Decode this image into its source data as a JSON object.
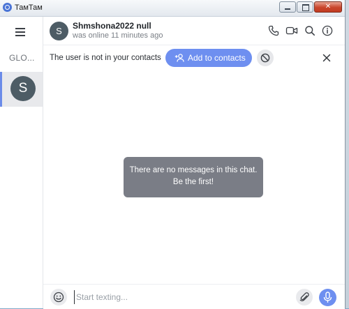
{
  "window": {
    "title": "ТамТам",
    "minimize_glyph": "",
    "maximize_glyph": "",
    "close_glyph": "✕"
  },
  "sidebar": {
    "global_tab": "GLO...",
    "chat": {
      "avatar_letter": "S"
    }
  },
  "header": {
    "avatar_letter": "S",
    "name": "Shmshona2022 null",
    "status": "was online 11 minutes ago",
    "icons": [
      "phone-icon",
      "video-camera-icon",
      "search-icon",
      "info-icon"
    ]
  },
  "contact_bar": {
    "notice": "The user is not in your contacts",
    "add_label": "Add to contacts"
  },
  "messages": {
    "empty_line1": "There are no messages in this chat.",
    "empty_line2": "Be the first!"
  },
  "composer": {
    "placeholder": "Start texting..."
  },
  "colors": {
    "accent": "#6e8ff0",
    "avatar": "#4d5c65",
    "empty_box": "#7a7d86"
  }
}
